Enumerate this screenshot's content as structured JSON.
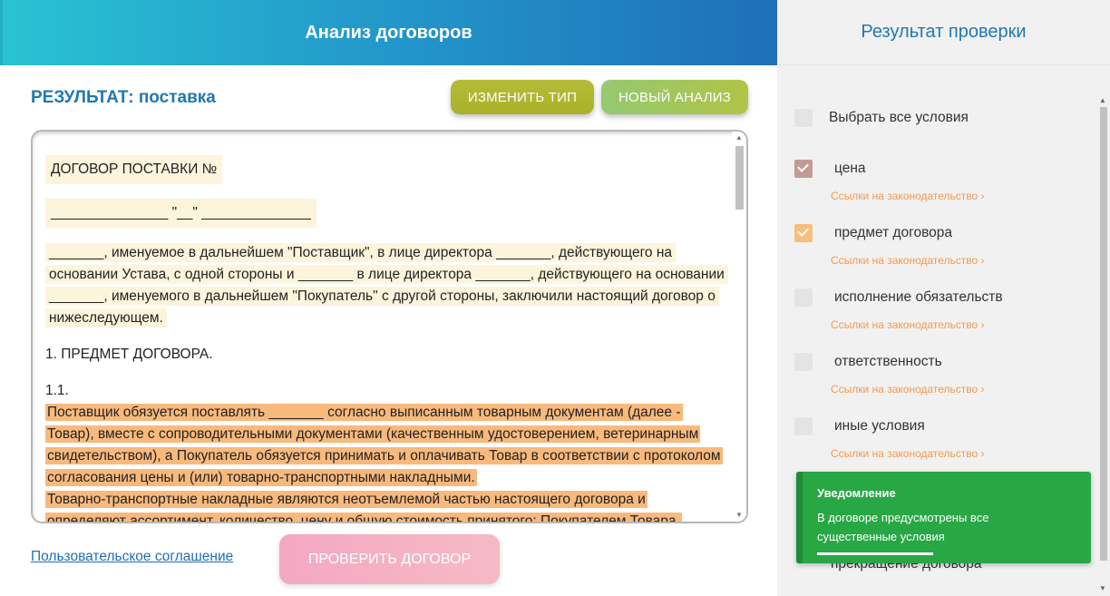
{
  "header": {
    "title": "Анализ договоров"
  },
  "right_header": {
    "title": "Результат проверки"
  },
  "result": {
    "label": "РЕЗУЛЬТАТ: поставка"
  },
  "buttons": {
    "change_type": "ИЗМЕНИТЬ ТИП",
    "new_analysis": "НОВЫЙ АНАЛИЗ",
    "check_contract": "ПРОВЕРИТЬ ДОГОВОР"
  },
  "document": {
    "title": "ДОГОВОР ПОСТАВКИ №",
    "date_line": "_______________ \"__\" ______________",
    "intro": " _______, именуемое в дальнейшем \"Поставщик\", в лице директора _______, действующего на основании Устава, с одной стороны и _______ в лице директора _______, действующего на основании _______, именуемого в дальнейшем \"Покупатель\" с другой стороны, заключили настоящий договор о нижеследующем.",
    "section_1": "1. ПРЕДМЕТ ДОГОВОРА.",
    "clause_num": "1.1.",
    "clause_text_1": " Поставщик обязуется поставлять _______ согласно выписанным товарным документам (далее - Товар), вместе с сопроводительными документами (качественным удостоверением, ветеринарным свидетельством), а Покупатель обязуется принимать и оплачивать Товар в соответствии с протоколом согласования цены и (или) товарно-транспортными накладными. ",
    "clause_text_2": " Товарно-транспортные накладные являются неотъемлемой частью настоящего договора и определяют ассортимент, количество, цену и общую стоимость принятого; Покупателем Товара."
  },
  "footer": {
    "agreement_link": "Пользовательское соглашение"
  },
  "conditions": {
    "select_all": "Выбрать все условия",
    "law_link": "Ссылки на законодательство ›",
    "items": [
      {
        "label": "цена",
        "checked": true
      },
      {
        "label": "предмет договора",
        "checked": true
      },
      {
        "label": "исполнение обязательств",
        "checked": false
      },
      {
        "label": "ответственность",
        "checked": false
      },
      {
        "label": "иные условия",
        "checked": false
      }
    ],
    "hidden_item": "прекращение договора"
  },
  "notification": {
    "title": "Уведомление",
    "text": "В договоре предусмотрены все существенные условия"
  },
  "colors": {
    "accent": "#1f78b4",
    "toast": "#28a745",
    "highlight_orange": "#f8b97d",
    "highlight_light": "#fdf4dc"
  }
}
